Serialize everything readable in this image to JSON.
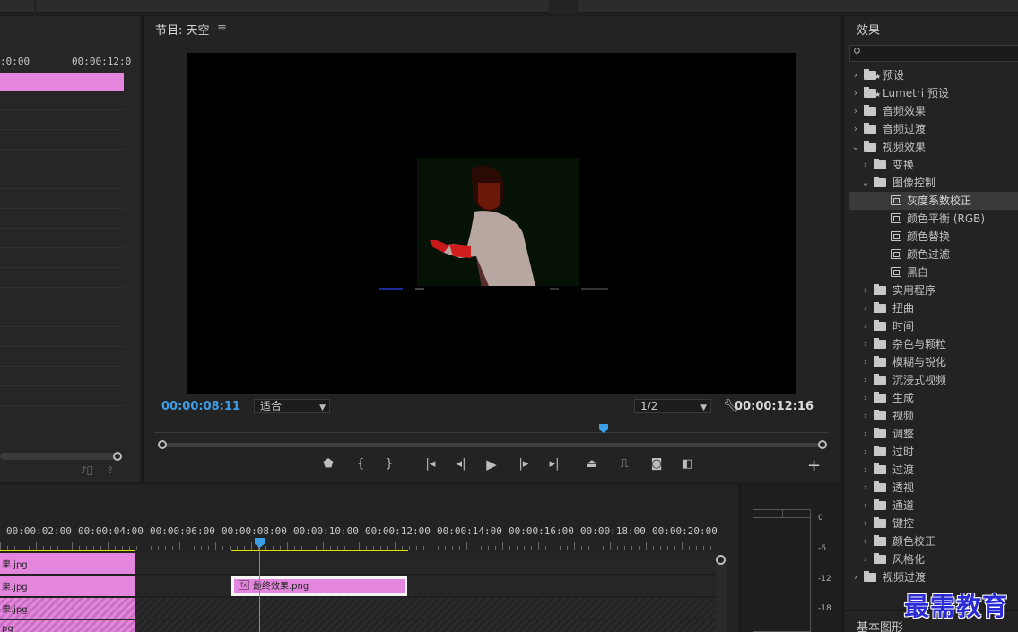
{
  "source": {
    "ruler_labels": [
      ":0:00",
      "00:00:12:0"
    ],
    "footer_icons": [
      "audio-only-icon",
      "export-icon"
    ]
  },
  "program": {
    "title": "节目: 天空",
    "menu_icon": "≡",
    "timecode_current": "00:00:08:11",
    "timecode_duration": "00:00:12:16",
    "zoom": "适合",
    "resolution": "1/2",
    "playhead_position_fraction": 0.66,
    "controls": [
      "marker-icon",
      "mark-in-icon",
      "mark-out-icon",
      "go-to-in-icon",
      "step-back-icon",
      "play-icon",
      "step-forward-icon",
      "go-to-out-icon",
      "lift-icon",
      "extract-icon",
      "export-frame-icon",
      "comparison-view-icon"
    ],
    "add_label": "+"
  },
  "effects": {
    "title": "效果",
    "search_placeholder": "",
    "tree": [
      {
        "label": "预设",
        "level": 0,
        "expanded": false,
        "type": "folder-star"
      },
      {
        "label": "Lumetri 预设",
        "level": 0,
        "expanded": false,
        "type": "folder-star"
      },
      {
        "label": "音频效果",
        "level": 0,
        "expanded": false,
        "type": "folder"
      },
      {
        "label": "音频过渡",
        "level": 0,
        "expanded": false,
        "type": "folder"
      },
      {
        "label": "视频效果",
        "level": 0,
        "expanded": true,
        "type": "folder"
      },
      {
        "label": "变换",
        "level": 1,
        "expanded": false,
        "type": "folder"
      },
      {
        "label": "图像控制",
        "level": 1,
        "expanded": true,
        "type": "folder"
      },
      {
        "label": "灰度系数校正",
        "level": 2,
        "type": "effect",
        "selected": true
      },
      {
        "label": "颜色平衡 (RGB)",
        "level": 2,
        "type": "effect"
      },
      {
        "label": "颜色替换",
        "level": 2,
        "type": "effect"
      },
      {
        "label": "颜色过滤",
        "level": 2,
        "type": "effect"
      },
      {
        "label": "黑白",
        "level": 2,
        "type": "effect"
      },
      {
        "label": "实用程序",
        "level": 1,
        "expanded": false,
        "type": "folder"
      },
      {
        "label": "扭曲",
        "level": 1,
        "expanded": false,
        "type": "folder"
      },
      {
        "label": "时间",
        "level": 1,
        "expanded": false,
        "type": "folder"
      },
      {
        "label": "杂色与颗粒",
        "level": 1,
        "expanded": false,
        "type": "folder"
      },
      {
        "label": "模糊与锐化",
        "level": 1,
        "expanded": false,
        "type": "folder"
      },
      {
        "label": "沉浸式视频",
        "level": 1,
        "expanded": false,
        "type": "folder"
      },
      {
        "label": "生成",
        "level": 1,
        "expanded": false,
        "type": "folder"
      },
      {
        "label": "视频",
        "level": 1,
        "expanded": false,
        "type": "folder"
      },
      {
        "label": "调整",
        "level": 1,
        "expanded": false,
        "type": "folder"
      },
      {
        "label": "过时",
        "level": 1,
        "expanded": false,
        "type": "folder"
      },
      {
        "label": "过渡",
        "level": 1,
        "expanded": false,
        "type": "folder"
      },
      {
        "label": "透视",
        "level": 1,
        "expanded": false,
        "type": "folder"
      },
      {
        "label": "通道",
        "level": 1,
        "expanded": false,
        "type": "folder"
      },
      {
        "label": "键控",
        "level": 1,
        "expanded": false,
        "type": "folder"
      },
      {
        "label": "颜色校正",
        "level": 1,
        "expanded": false,
        "type": "folder"
      },
      {
        "label": "风格化",
        "level": 1,
        "expanded": false,
        "type": "folder"
      },
      {
        "label": "视频过渡",
        "level": 0,
        "expanded": false,
        "type": "folder"
      }
    ],
    "basic_graphics_title": "基本图形"
  },
  "timeline": {
    "ruler_labels": [
      "00:00:02:00",
      "00:00:04:00",
      "00:00:06:00",
      "00:00:08:00",
      "00:00:10:00",
      "00:00:12:00",
      "00:00:14:00",
      "00:00:16:00",
      "00:00:18:00",
      "00:00:20:00"
    ],
    "tracks": [
      {
        "clip_label": "果.jpg"
      },
      {
        "clip_label": "果.jpg"
      },
      {
        "clip_label": "果.jpg"
      },
      {
        "clip_label": "pg"
      }
    ],
    "final_clip": {
      "fx": "fx",
      "name": "最终效果.png"
    }
  },
  "meter": {
    "db_labels": [
      "0",
      "-6",
      "-12",
      "-18"
    ]
  },
  "watermark": "最需教育",
  "colors": {
    "accent_blue": "#3d9ee8",
    "clip_pink": "#e586de",
    "work_area_yellow": "#e6e000",
    "watermark_blue": "#2b2bd6"
  }
}
